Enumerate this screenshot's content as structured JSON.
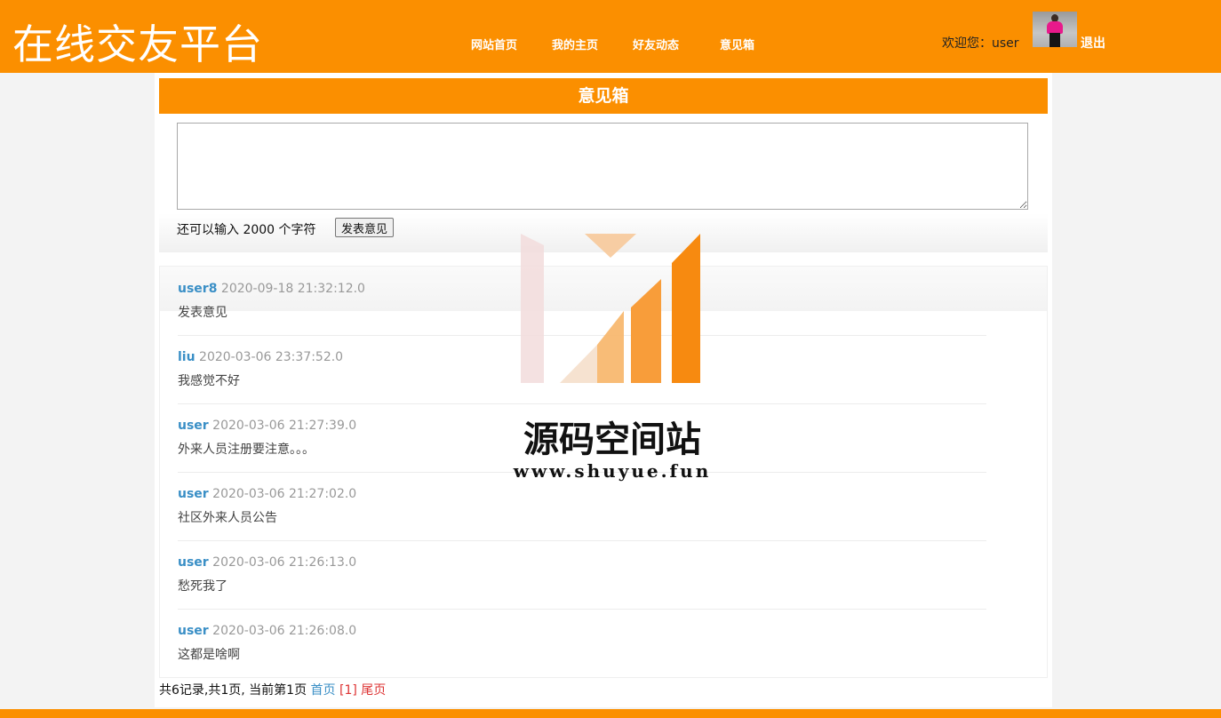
{
  "header": {
    "site_title": "在线交友平台",
    "nav": [
      "网站首页",
      "我的主页",
      "好友动态",
      "意见箱"
    ],
    "welcome": "欢迎您：user",
    "logout": "退出"
  },
  "feedback": {
    "title": "意见箱",
    "textarea_value": "",
    "counter_text": "还可以输入 2000 个字符",
    "submit_label": "发表意见"
  },
  "entries": [
    {
      "user": "user8",
      "time": "2020-09-18 21:32:12.0",
      "content": "发表意见"
    },
    {
      "user": "liu",
      "time": "2020-03-06 23:37:52.0",
      "content": "我感觉不好"
    },
    {
      "user": "user",
      "time": "2020-03-06 21:27:39.0",
      "content": "外来人员注册要注意。。。"
    },
    {
      "user": "user",
      "time": "2020-03-06 21:27:02.0",
      "content": "社区外来人员公告"
    },
    {
      "user": "user",
      "time": "2020-03-06 21:26:13.0",
      "content": "愁死我了"
    },
    {
      "user": "user",
      "time": "2020-03-06 21:26:08.0",
      "content": "这都是啥啊"
    }
  ],
  "pager": {
    "summary": "共6记录,共1页, 当前第1页",
    "first": "首页",
    "current": "[1]",
    "last": "尾页"
  },
  "watermark": {
    "name": "源码空间站",
    "url": "www.shuyue.fun"
  },
  "colors": {
    "accent": "#fb8f00",
    "link": "#3a8fc6",
    "current_page": "#dd3333"
  }
}
